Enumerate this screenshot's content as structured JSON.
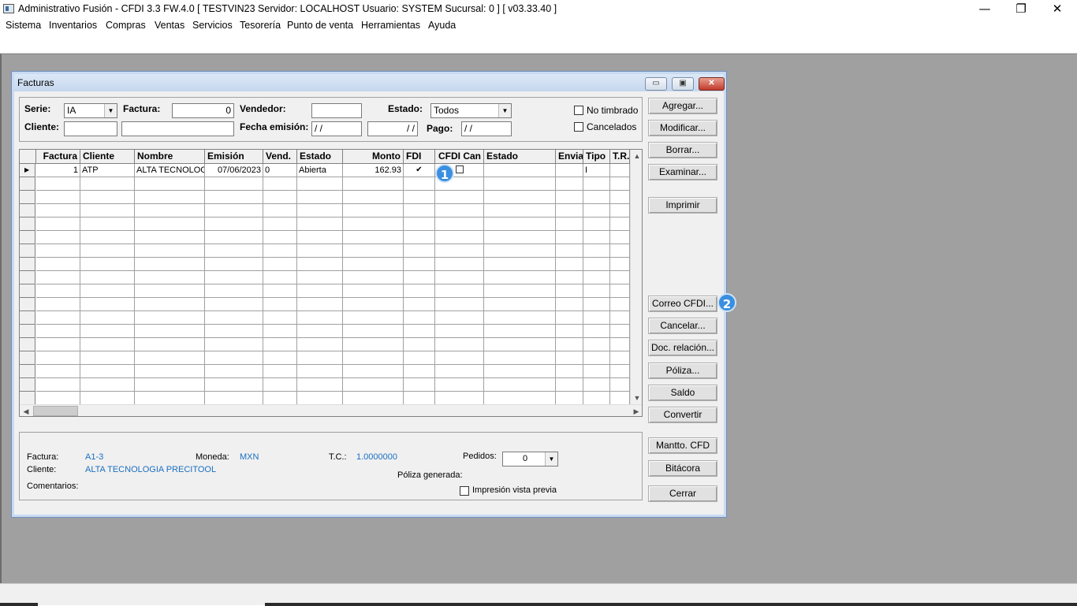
{
  "app": {
    "title": "Administrativo Fusión - CFDI 3.3 FW.4.0 [ TESTVIN23   Servidor: LOCALHOST   Usuario: SYSTEM     Sucursal: 0 ] [ v03.33.40 ]",
    "minimize": "—",
    "maximize": "❐",
    "close": "✕"
  },
  "menu": [
    "Sistema",
    "Inventarios",
    "Compras",
    "Ventas",
    "Servicios",
    "Tesorería",
    "Punto de venta",
    "Herramientas",
    "Ayuda"
  ],
  "window": {
    "title": "Facturas",
    "min": "▭",
    "max": "▣",
    "close": "✕"
  },
  "filter": {
    "serie_label": "Serie:",
    "serie_value": "IA",
    "factura_label": "Factura:",
    "factura_value": "0",
    "vendedor_label": "Vendedor:",
    "vendedor_value": "",
    "estado_label": "Estado:",
    "estado_value": "Todos",
    "no_timbrado_label": "No timbrado",
    "cancelados_label": "Cancelados",
    "cliente_label": "Cliente:",
    "cliente_code": "",
    "cliente_name": "",
    "fecha_label": "Fecha emisión:",
    "fecha_desde": "/ /",
    "fecha_hasta": "/ /",
    "pago_label": "Pago:",
    "pago_value": "/ /"
  },
  "grid": {
    "columns": [
      "Factura",
      "Cliente",
      "Nombre",
      "Emisión",
      "Vend.",
      "Estado",
      "Monto",
      "FDI",
      "CFDI Can",
      "Estado",
      "Envia",
      "Tipo",
      "T.R."
    ],
    "rows": [
      {
        "factura": "1",
        "cliente": "ATP",
        "nombre": "ALTA TECNOLOG",
        "emision": "07/06/2023",
        "vend": "0",
        "estado": "Abierta",
        "monto": "162.93",
        "fdi": "✔",
        "cfdi_can": "",
        "estado2": "",
        "envia": "",
        "tipo": "I",
        "tr": ""
      }
    ]
  },
  "buttons": {
    "agregar": "Agregar...",
    "modificar": "Modificar...",
    "borrar": "Borrar...",
    "examinar": "Examinar...",
    "imprimir": "Imprimir",
    "correo": "Correo CFDI...",
    "cancelar": "Cancelar...",
    "doc_relacion": "Doc. relación...",
    "poliza": "Póliza...",
    "saldo": "Saldo",
    "convertir": "Convertir",
    "mantto": "Mantto. CFD",
    "bitacora": "Bitácora",
    "cerrar": "Cerrar"
  },
  "info": {
    "factura_label": "Factura:",
    "factura_value": "A1-3",
    "moneda_label": "Moneda:",
    "moneda_value": "MXN",
    "tc_label": "T.C.:",
    "tc_value": "1.0000000",
    "pedidos_label": "Pedidos:",
    "pedidos_value": "0",
    "cliente_label": "Cliente:",
    "cliente_value": "ALTA TECNOLOGIA PRECITOOL",
    "poliza_label": "Póliza generada:",
    "comentarios_label": "Comentarios:",
    "impresion_label": "Impresión vista previa"
  },
  "badges": [
    "1",
    "2"
  ],
  "colors": {
    "link_blue": "#1a6fc2",
    "badge_blue": "#3a8fe0",
    "mdi_bg": "#a0a0a0"
  }
}
